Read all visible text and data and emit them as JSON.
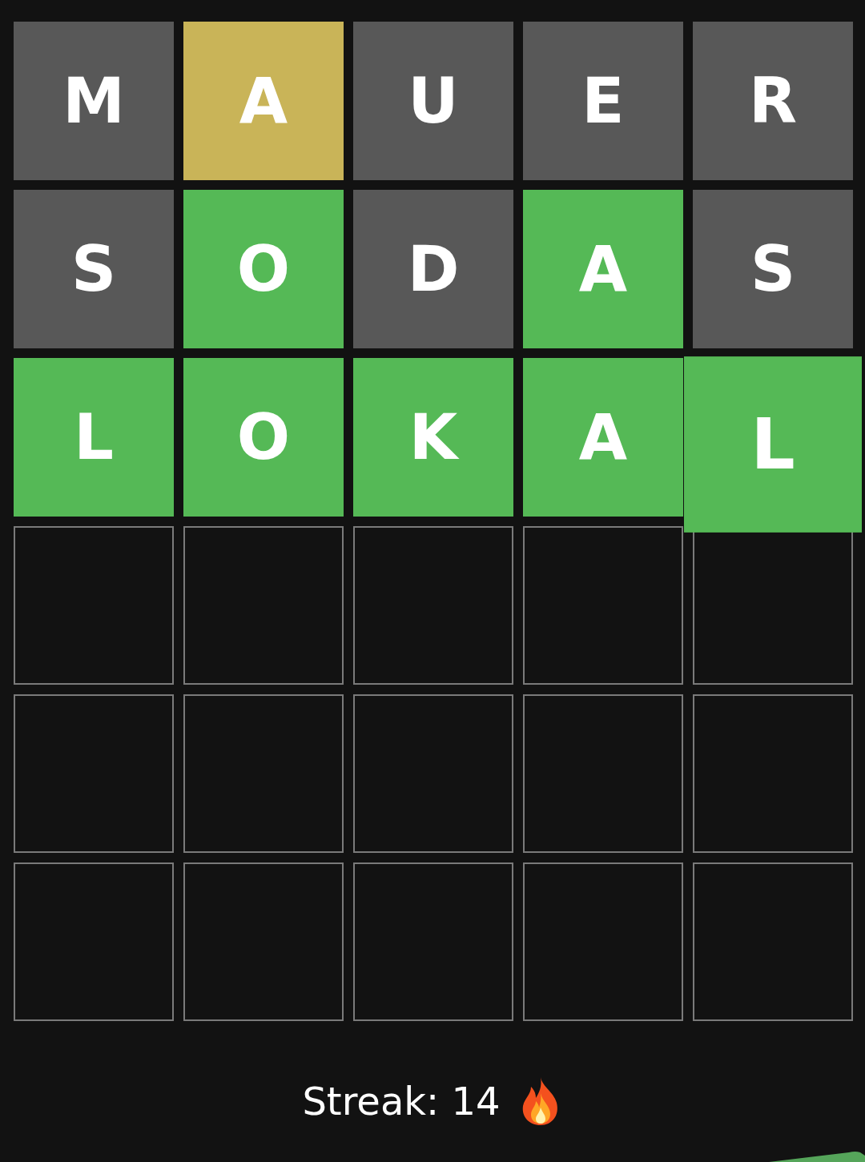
{
  "board": {
    "rows": [
      {
        "tiles": [
          {
            "letter": "M",
            "kind": "absent",
            "popped": false
          },
          {
            "letter": "A",
            "kind": "present",
            "popped": false
          },
          {
            "letter": "U",
            "kind": "absent",
            "popped": false
          },
          {
            "letter": "E",
            "kind": "absent",
            "popped": false
          },
          {
            "letter": "R",
            "kind": "absent",
            "popped": false
          }
        ]
      },
      {
        "tiles": [
          {
            "letter": "S",
            "kind": "absent",
            "popped": false
          },
          {
            "letter": "O",
            "kind": "correct",
            "popped": false
          },
          {
            "letter": "D",
            "kind": "absent",
            "popped": false
          },
          {
            "letter": "A",
            "kind": "correct",
            "popped": false
          },
          {
            "letter": "S",
            "kind": "absent",
            "popped": false
          }
        ]
      },
      {
        "tiles": [
          {
            "letter": "L",
            "kind": "correct",
            "popped": false
          },
          {
            "letter": "O",
            "kind": "correct",
            "popped": false
          },
          {
            "letter": "K",
            "kind": "correct",
            "popped": false
          },
          {
            "letter": "A",
            "kind": "correct",
            "popped": false
          },
          {
            "letter": "L",
            "kind": "correct",
            "popped": true
          }
        ]
      },
      {
        "tiles": [
          {
            "kind": "empty",
            "popped": false
          },
          {
            "kind": "empty",
            "popped": false
          },
          {
            "kind": "empty",
            "popped": false
          },
          {
            "kind": "empty",
            "popped": false
          },
          {
            "kind": "empty",
            "popped": false
          }
        ]
      },
      {
        "tiles": [
          {
            "kind": "empty",
            "popped": false
          },
          {
            "kind": "empty",
            "popped": false
          },
          {
            "kind": "empty",
            "popped": false
          },
          {
            "kind": "empty",
            "popped": false
          },
          {
            "kind": "empty",
            "popped": false
          }
        ]
      },
      {
        "tiles": [
          {
            "kind": "empty",
            "popped": false
          },
          {
            "kind": "empty",
            "popped": false
          },
          {
            "kind": "empty",
            "popped": false
          },
          {
            "kind": "empty",
            "popped": false
          },
          {
            "kind": "empty",
            "popped": false
          }
        ]
      }
    ]
  },
  "streak": {
    "label": "Streak: 14"
  }
}
